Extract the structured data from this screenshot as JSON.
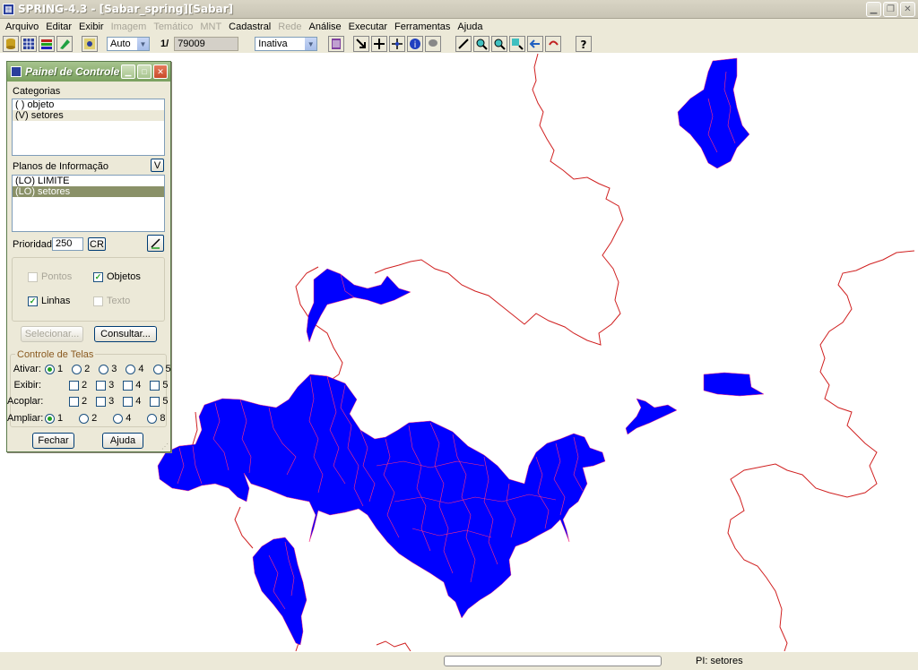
{
  "app": {
    "title": "SPRING-4.3 - [Sabar_spring][Sabar]"
  },
  "menu": [
    {
      "label": "Arquivo",
      "enabled": true
    },
    {
      "label": "Editar",
      "enabled": true
    },
    {
      "label": "Exibir",
      "enabled": true
    },
    {
      "label": "Imagem",
      "enabled": false
    },
    {
      "label": "Temático",
      "enabled": false
    },
    {
      "label": "MNT",
      "enabled": false
    },
    {
      "label": "Cadastral",
      "enabled": true
    },
    {
      "label": "Rede",
      "enabled": false
    },
    {
      "label": "Análise",
      "enabled": true
    },
    {
      "label": "Executar",
      "enabled": true
    },
    {
      "label": "Ferramentas",
      "enabled": true
    },
    {
      "label": "Ajuda",
      "enabled": true
    }
  ],
  "toolbar": {
    "zoom_mode": "Auto",
    "scale_prefix": "1/",
    "scale_value": "79009",
    "mode": "Inativa"
  },
  "panel": {
    "title": "Painel de Controle",
    "categorias_label": "Categorias",
    "categorias": [
      "( ) objeto",
      "(V) setores"
    ],
    "planos_label": "Planos de Informação",
    "planos_btn": "V",
    "planos": [
      "(LO) LIMITE",
      "(LO) setores"
    ],
    "prioridade_label": "Prioridade:",
    "prioridade_value": "250",
    "cr_btn": "CR",
    "pontos": "Pontos",
    "objetos": "Objetos",
    "linhas": "Linhas",
    "texto": "Texto",
    "selecionar_btn": "Selecionar...",
    "consultar_btn": "Consultar...",
    "telas_label": "Controle de Telas",
    "ativar_label": "Ativar:",
    "exibir_label": "Exibir:",
    "acoplar_label": "Acoplar:",
    "ampliar_label": "Ampliar:",
    "ativar_opts": [
      "1",
      "2",
      "3",
      "4",
      "5"
    ],
    "exibir_opts": [
      "2",
      "3",
      "4",
      "5"
    ],
    "acoplar_opts": [
      "2",
      "3",
      "4",
      "5"
    ],
    "ampliar_opts": [
      "1",
      "2",
      "4",
      "8"
    ],
    "fechar_btn": "Fechar",
    "ajuda_btn": "Ajuda"
  },
  "status": {
    "pi": "PI: setores"
  },
  "colors": {
    "polygon_fill": "#0000ff",
    "boundary": "#d02020"
  }
}
